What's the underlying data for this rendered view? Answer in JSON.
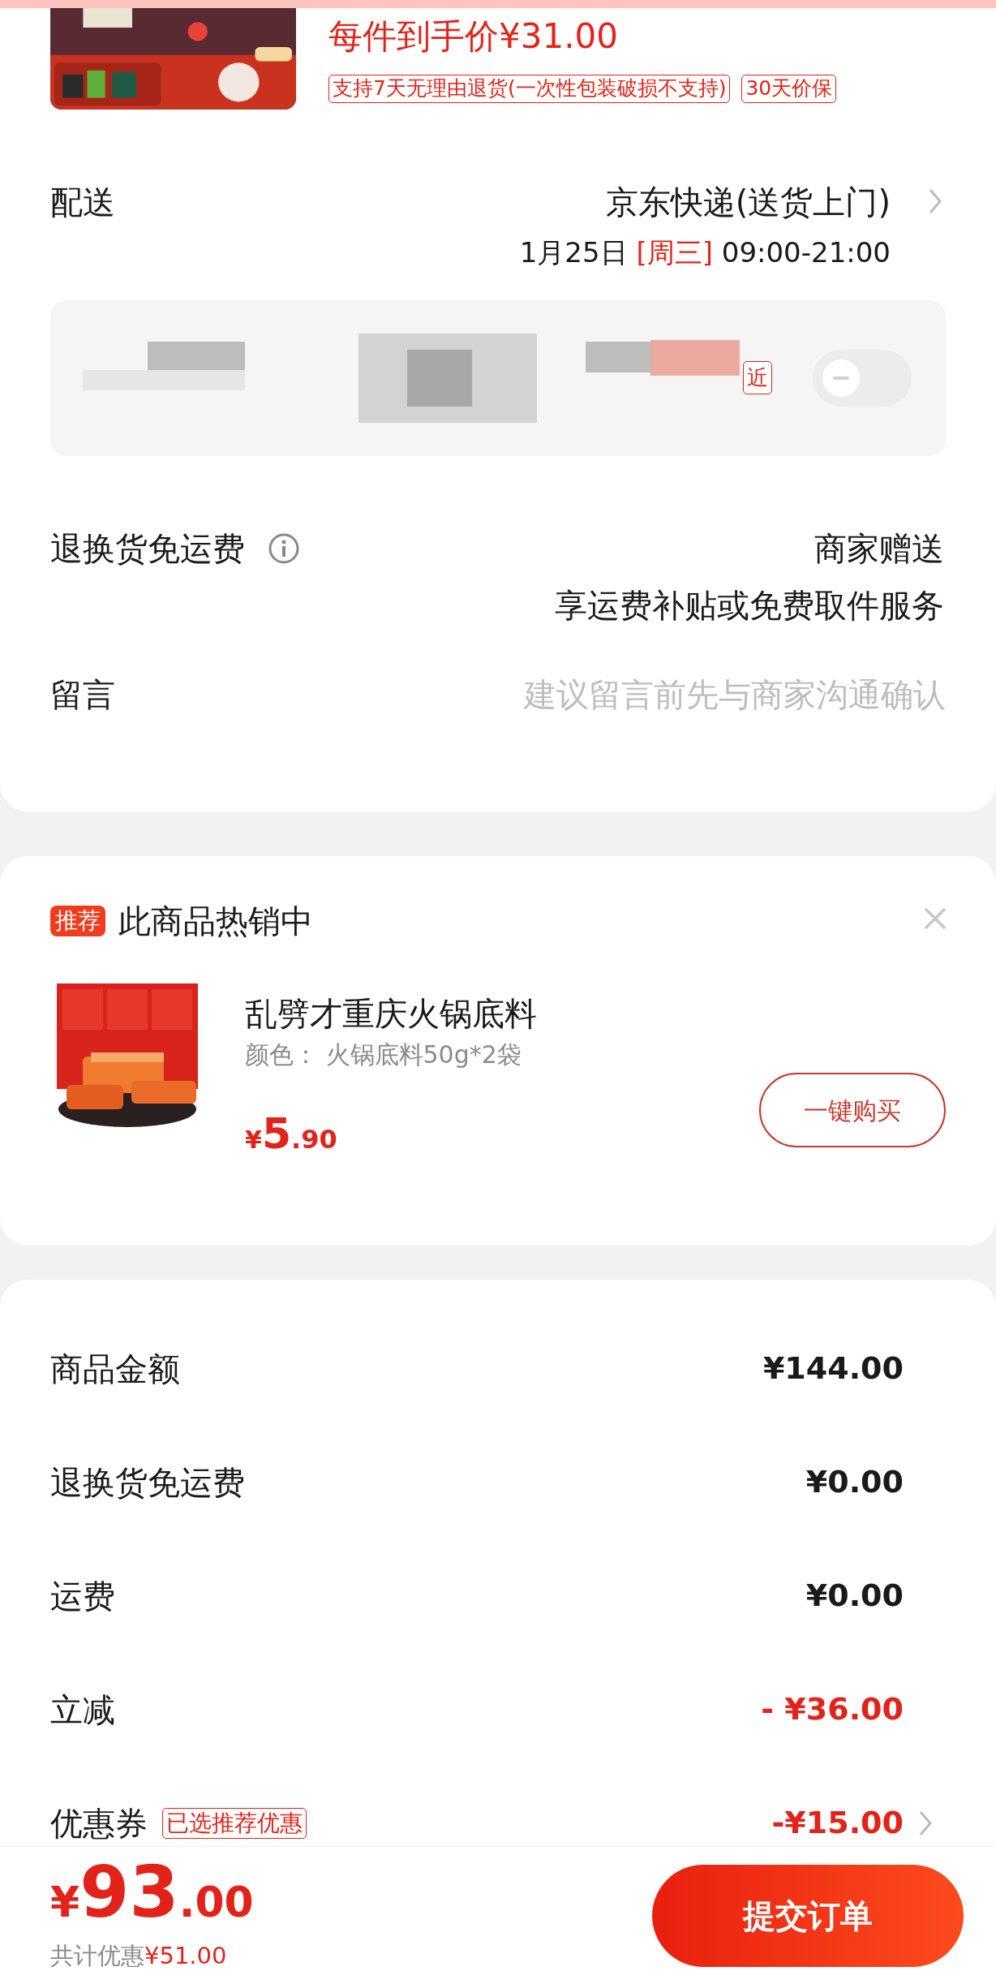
{
  "product": {
    "kind": "picture",
    "unit_price": "每件到手价¥31.00",
    "tags": [
      "支持7天无理由退货(一次性包装破损不支持)",
      "30天价保"
    ]
  },
  "delivery": {
    "label": "配送",
    "carrier": "京东快递(送货上门)",
    "date": "1月25日",
    "weekday": "[周三]",
    "time": "09:00-21:00"
  },
  "contactless": {
    "tag": "近",
    "on": false
  },
  "return_shipping": {
    "label": "退换货免运费",
    "value": "商家赠送",
    "note": "享运费补贴或免费取件服务"
  },
  "message": {
    "label": "留言",
    "placeholder": "建议留言前先与商家沟通确认"
  },
  "recommendation": {
    "badge": "推荐",
    "title": "此商品热销中",
    "item": {
      "kind": "picture",
      "name": "乱劈才重庆火锅底料",
      "spec": "颜色： 火锅底料50g*2袋",
      "currency": "¥",
      "price_int": "5",
      "price_dec": ".90"
    },
    "button": "一键购买"
  },
  "summary": [
    {
      "kind": "plain",
      "label": "商品金额",
      "value": "¥144.00"
    },
    {
      "kind": "plain",
      "label": "退换货免运费",
      "value": "¥0.00"
    },
    {
      "kind": "plain",
      "label": "运费",
      "value": "¥0.00"
    },
    {
      "kind": "discount",
      "label": "立减",
      "value": "- ¥36.00"
    },
    {
      "kind": "coupon",
      "label": "优惠券",
      "tag": "已选推荐优惠",
      "value": "-¥15.00"
    }
  ],
  "footer": {
    "currency": "¥",
    "total_int": "93",
    "total_dec": ".00",
    "savings_label": "共计优惠",
    "savings": "¥51.00",
    "submit": "提交订单"
  }
}
